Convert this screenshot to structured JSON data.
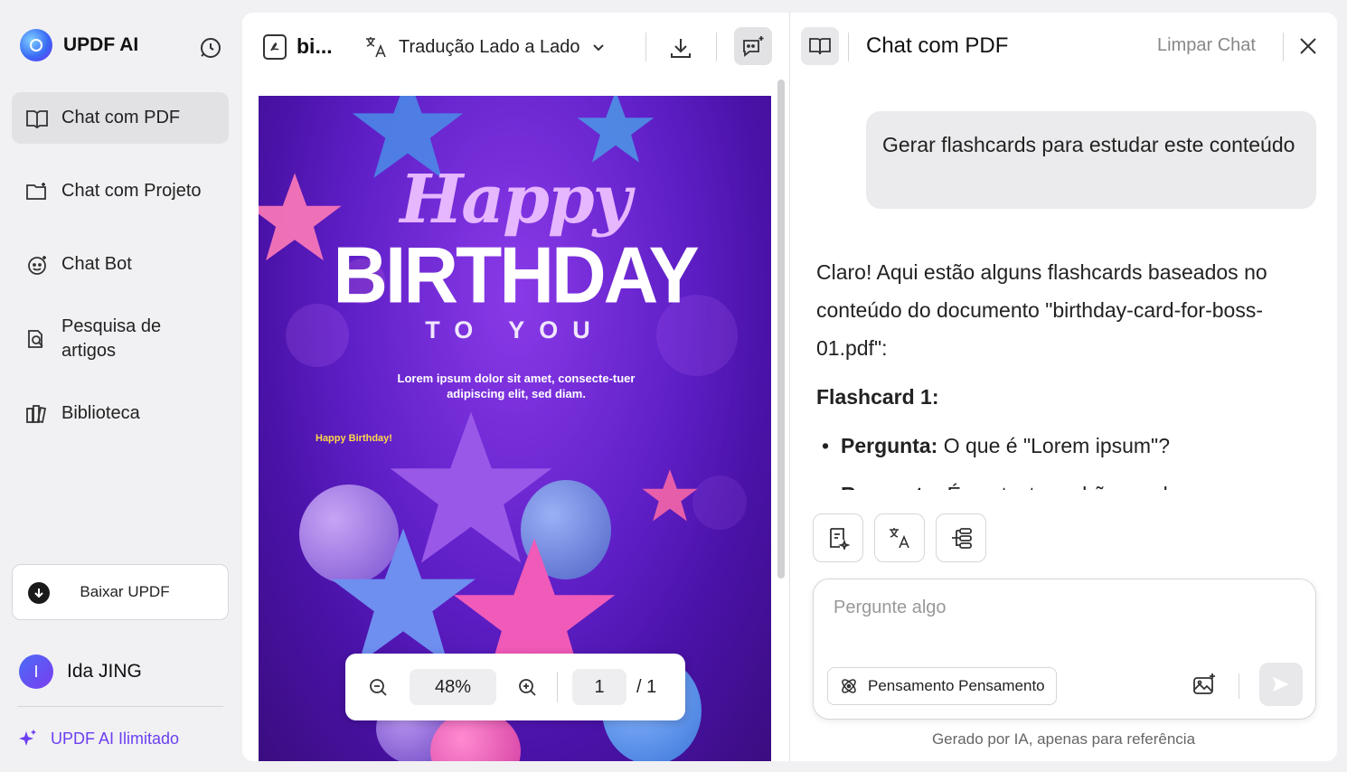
{
  "app": {
    "brand": "UPDF AI"
  },
  "sidebar": {
    "items": [
      {
        "label": "Chat com PDF",
        "icon": "book-open-icon",
        "active": true
      },
      {
        "label": "Chat com Projeto",
        "icon": "folder-sparkle-icon",
        "active": false
      },
      {
        "label": "Chat Bot",
        "icon": "bot-icon",
        "active": false
      },
      {
        "label": "Pesquisa de artigos",
        "icon": "article-search-icon",
        "active": false
      },
      {
        "label": "Biblioteca",
        "icon": "library-icon",
        "active": false
      }
    ],
    "download_label": "Baixar UPDF",
    "user_initial": "I",
    "user_name": "Ida JING",
    "unlimited_label": "UPDF AI Ilimitado"
  },
  "pdf_toolbar": {
    "file_name": "bi...",
    "translate_label": "Tradução Lado a Lado"
  },
  "pdf": {
    "happy": "Happy",
    "birthday": "BIRTHDAY",
    "to_you": "TO YOU",
    "lorem": "Lorem ipsum dolor sit amet, consecte-tuer adipiscing elit, sed diam.",
    "small_text": "Happy Birthday!"
  },
  "zoom": {
    "value": "48%",
    "page": "1",
    "total": "/ 1"
  },
  "chat": {
    "title": "Chat com PDF",
    "clear_label": "Limpar Chat",
    "user_message": "Gerar flashcards para estudar este conteúdo",
    "ai_intro": "Claro! Aqui estão alguns flashcards baseados no conteúdo do documento \"birthday-card-for-boss-01.pdf\":",
    "flashcard_title": "Flashcard 1:",
    "q_label": "Pergunta:",
    "q_text": " O que é \"Lorem ipsum\"?",
    "a_label": "Resposta:",
    "a_text": " É um texto padrão usado como",
    "input_placeholder": "Pergunte algo",
    "think_label": "Pensamento Pensamento",
    "disclaimer": "Gerado por IA, apenas para referência"
  },
  "colors": {
    "accent": "#6b3ff0",
    "active_bg": "#e2e2e5"
  }
}
